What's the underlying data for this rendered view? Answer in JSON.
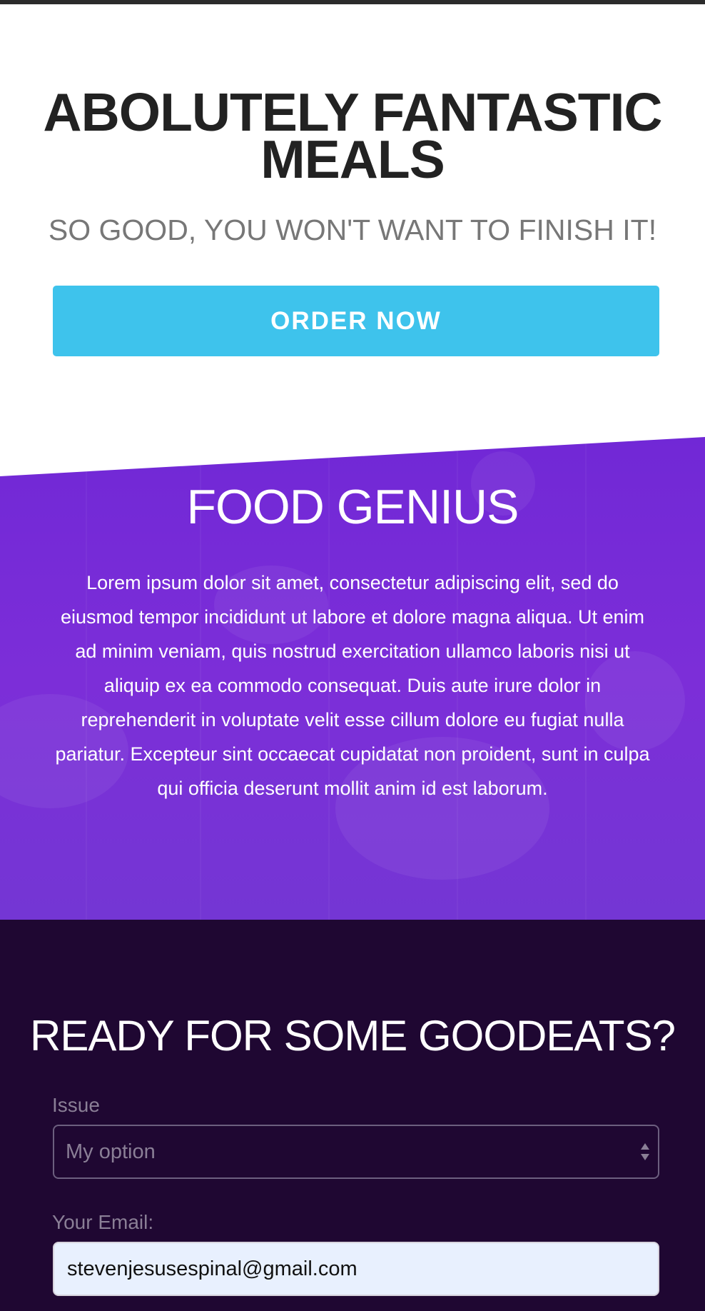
{
  "hero": {
    "title": "ABOLUTELY FANTASTIC MEALS",
    "subtitle": "SO GOOD, YOU WON'T WANT TO FINISH IT!",
    "cta_label": "ORDER NOW",
    "cta_color": "#3ec3ec"
  },
  "about": {
    "title": "FOOD GENIUS",
    "body": "Lorem ipsum dolor sit amet, consectetur adipiscing elit, sed do eiusmod tempor incididunt ut labore et dolore magna aliqua. Ut enim ad minim veniam, quis nostrud exercitation ullamco laboris nisi ut aliquip ex ea commodo consequat. Duis aute irure dolor in reprehenderit in voluptate velit esse cillum dolore eu fugiat nulla pariatur. Excepteur sint occaecat cupidatat non proident, sunt in culpa qui officia deserunt mollit anim id est laborum.",
    "background_color": "#7b2fd8"
  },
  "signup": {
    "title": "READY FOR SOME GOODEATS?",
    "background_color": "#1f0732",
    "issue": {
      "label": "Issue",
      "selected": "My option"
    },
    "email": {
      "label": "Your Email:",
      "value": "stevenjesusespinal@gmail.com"
    }
  }
}
